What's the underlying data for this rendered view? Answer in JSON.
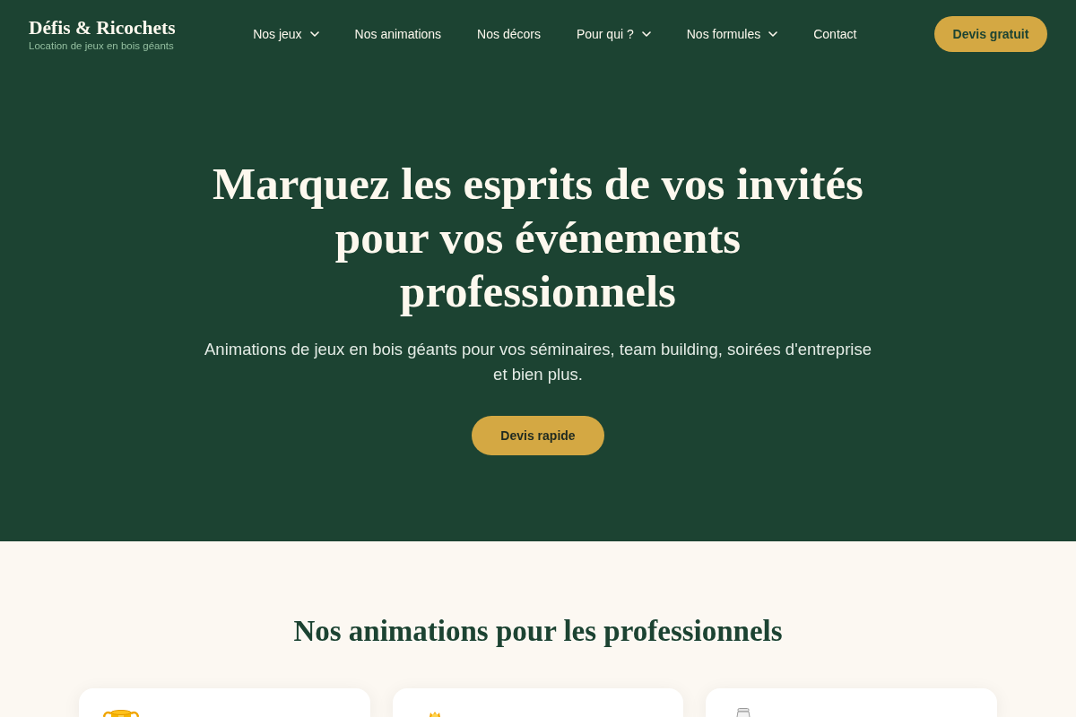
{
  "header": {
    "logo": {
      "title": "Défis & Ricochets",
      "tagline": "Location de jeux en bois géants"
    },
    "nav": [
      {
        "label": "Nos jeux",
        "dropdown": true
      },
      {
        "label": "Nos animations",
        "dropdown": false
      },
      {
        "label": "Nos décors",
        "dropdown": false
      },
      {
        "label": "Pour qui ?",
        "dropdown": true
      },
      {
        "label": "Nos formules",
        "dropdown": true
      },
      {
        "label": "Contact",
        "dropdown": false
      }
    ],
    "cta_button": "Devis gratuit"
  },
  "hero": {
    "title": "Marquez les esprits de vos invités pour vos événements professionnels",
    "subtitle": "Animations de jeux en bois géants pour vos séminaires, team building, soirées d'entreprise et bien plus.",
    "button": "Devis rapide"
  },
  "animations": {
    "title": "Nos animations pour les professionnels",
    "cards": [
      {
        "kind": "trophy"
      },
      {
        "kind": "crown"
      },
      {
        "kind": "jar"
      }
    ]
  }
}
